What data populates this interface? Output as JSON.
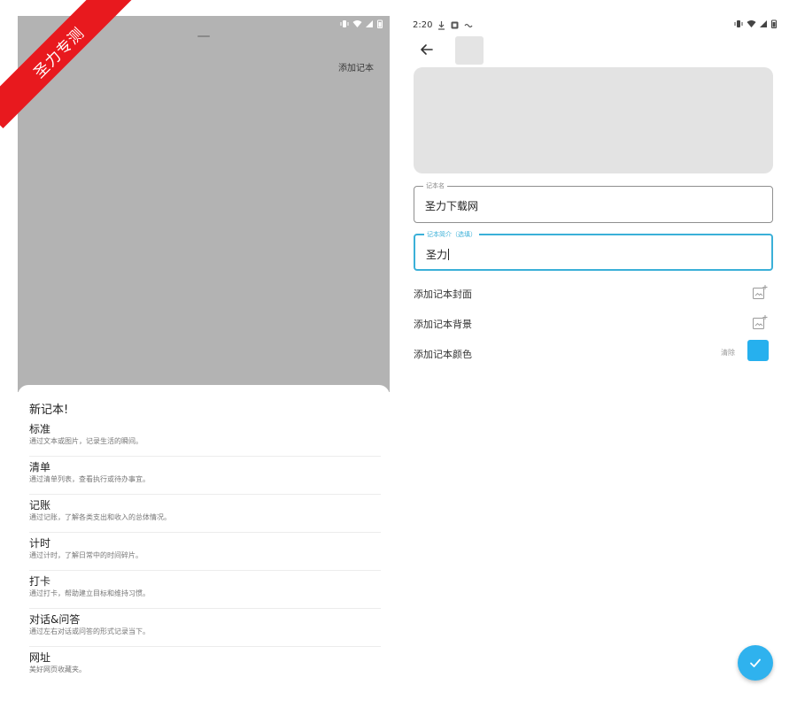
{
  "left": {
    "status_icons": [
      "vibrate-icon",
      "wifi-icon",
      "signal-icon",
      "battery-icon"
    ],
    "add_notebook": "添加记本",
    "sheet": {
      "title": "新记本!",
      "types": [
        {
          "name": "标准",
          "desc": "通过文本或图片，记录生活的瞬间。"
        },
        {
          "name": "清单",
          "desc": "通过清单列表，查看执行或待办事宜。"
        },
        {
          "name": "记账",
          "desc": "通过记账，了解各类支出和收入的总体情况。"
        },
        {
          "name": "计时",
          "desc": "通过计时，了解日常中的时间碎片。"
        },
        {
          "name": "打卡",
          "desc": "通过打卡，帮助建立目标和维持习惯。"
        },
        {
          "name": "对话&问答",
          "desc": "通过左右对话或问答的形式记录当下。"
        },
        {
          "name": "网址",
          "desc": "美好网页收藏夹。"
        }
      ]
    }
  },
  "right": {
    "status_time": "2:20",
    "name_field": {
      "label": "记本名",
      "value": "圣力下载网"
    },
    "intro_field": {
      "label": "记本简介（选填）",
      "value": "圣力"
    },
    "options": {
      "cover": "添加记本封面",
      "background": "添加记本背景",
      "color": "添加记本颜色",
      "clear": "清除"
    },
    "accent_color": "#26b0ee"
  },
  "watermark": "圣力专测"
}
